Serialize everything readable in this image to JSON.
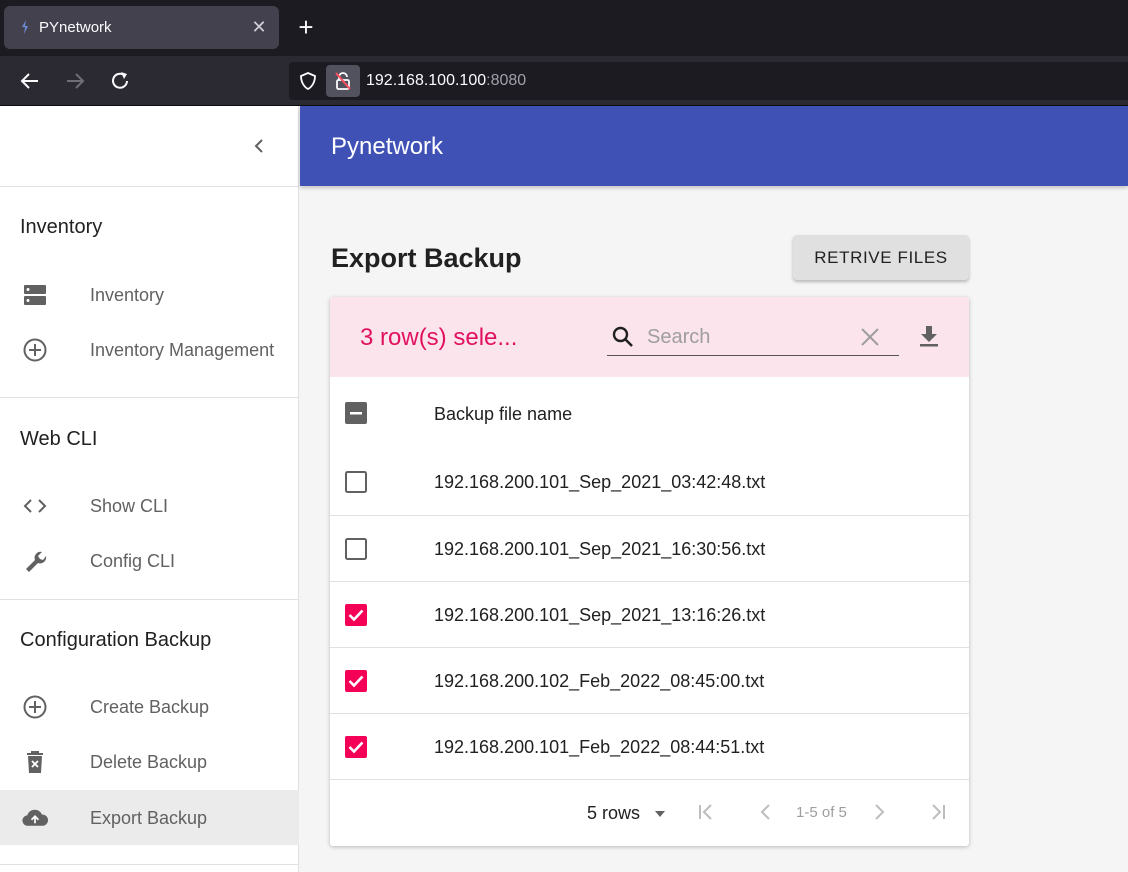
{
  "browser": {
    "tab_title": "PYnetwork",
    "url_host": "192.168.100.100",
    "url_port": ":8080"
  },
  "sidebar": {
    "sections": [
      {
        "heading": "Inventory",
        "items": [
          {
            "label": "Inventory",
            "icon": "server-icon"
          },
          {
            "label": "Inventory Management",
            "icon": "add-circle-icon"
          }
        ]
      },
      {
        "heading": "Web CLI",
        "items": [
          {
            "label": "Show CLI",
            "icon": "code-icon"
          },
          {
            "label": "Config CLI",
            "icon": "wrench-icon"
          }
        ]
      },
      {
        "heading": "Configuration Backup",
        "items": [
          {
            "label": "Create Backup",
            "icon": "add-circle-icon"
          },
          {
            "label": "Delete Backup",
            "icon": "delete-forever-icon"
          },
          {
            "label": "Export Backup",
            "icon": "cloud-upload-icon",
            "active": true
          }
        ]
      }
    ]
  },
  "header": {
    "title": "Pynetwork"
  },
  "main": {
    "title": "Export Backup",
    "retrieve_label": "RETRIVE FILES"
  },
  "table": {
    "selected_text": "3 row(s) sele...",
    "search_placeholder": "Search",
    "column_header": "Backup file name",
    "rows": [
      {
        "name": "192.168.200.101_Sep_2021_03:42:48.txt",
        "checked": false
      },
      {
        "name": "192.168.200.101_Sep_2021_16:30:56.txt",
        "checked": false
      },
      {
        "name": "192.168.200.101_Sep_2021_13:16:26.txt",
        "checked": true
      },
      {
        "name": "192.168.200.102_Feb_2022_08:45:00.txt",
        "checked": true
      },
      {
        "name": "192.168.200.101_Feb_2022_08:44:51.txt",
        "checked": true
      }
    ],
    "rows_per_page": "5 rows",
    "page_info": "1-5 of 5"
  },
  "colors": {
    "appbar": "#3f51b5",
    "selection_bg": "#fce4ec",
    "selection_text": "#e0115f",
    "checkbox_checked": "#f50057"
  }
}
